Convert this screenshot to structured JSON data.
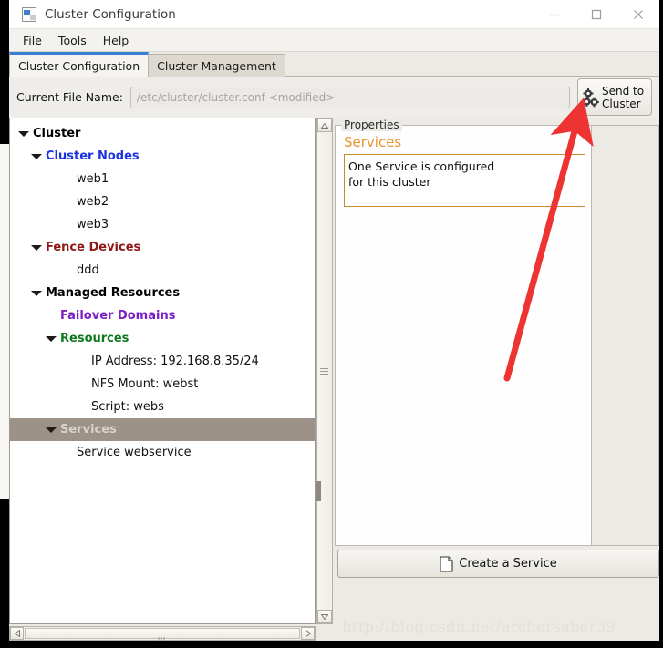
{
  "window": {
    "title": "Cluster Configuration",
    "icon": "app-icon",
    "controls": {
      "minimize": "minimize-icon",
      "maximize": "maximize-icon",
      "close": "close-icon"
    }
  },
  "menubar": {
    "items": [
      {
        "label": "File",
        "mnemonic": "F"
      },
      {
        "label": "Tools",
        "mnemonic": "T"
      },
      {
        "label": "Help",
        "mnemonic": "H"
      }
    ]
  },
  "tabs": [
    {
      "label": "Cluster Configuration",
      "active": true
    },
    {
      "label": "Cluster Management",
      "active": false
    }
  ],
  "toolbar": {
    "file_label": "Current File Name:",
    "file_value": "/etc/cluster/cluster.conf  <modified>",
    "file_placeholder": "/etc/cluster/cluster.conf  <modified>",
    "send_line1": "Send to",
    "send_line2": "Cluster",
    "send_icon": "gears-icon"
  },
  "tree": {
    "items": [
      {
        "label": "Cluster",
        "indent": 0,
        "arrow": true,
        "color": "#000000",
        "bold": true,
        "selected": false
      },
      {
        "label": "Cluster Nodes",
        "indent": 1,
        "arrow": true,
        "color": "#1b34e0",
        "bold": true,
        "selected": false
      },
      {
        "label": "web1",
        "indent": 3,
        "arrow": false,
        "color": "#111111",
        "bold": false,
        "selected": false
      },
      {
        "label": "web2",
        "indent": 3,
        "arrow": false,
        "color": "#111111",
        "bold": false,
        "selected": false
      },
      {
        "label": "web3",
        "indent": 3,
        "arrow": false,
        "color": "#111111",
        "bold": false,
        "selected": false
      },
      {
        "label": "Fence Devices",
        "indent": 1,
        "arrow": true,
        "color": "#8f1717",
        "bold": true,
        "selected": false
      },
      {
        "label": "ddd",
        "indent": 3,
        "arrow": false,
        "color": "#111111",
        "bold": false,
        "selected": false
      },
      {
        "label": "Managed Resources",
        "indent": 1,
        "arrow": true,
        "color": "#000000",
        "bold": true,
        "selected": false
      },
      {
        "label": "Failover Domains",
        "indent": 2,
        "arrow": false,
        "color": "#7a1ec4",
        "bold": true,
        "selected": false
      },
      {
        "label": "Resources",
        "indent": 2,
        "arrow": true,
        "color": "#0d7a1f",
        "bold": true,
        "selected": false
      },
      {
        "label": "IP Address:  192.168.8.35/24",
        "indent": 4,
        "arrow": false,
        "color": "#111111",
        "bold": false,
        "selected": false
      },
      {
        "label": "NFS Mount:  webst",
        "indent": 4,
        "arrow": false,
        "color": "#111111",
        "bold": false,
        "selected": false
      },
      {
        "label": "Script:  webs",
        "indent": 4,
        "arrow": false,
        "color": "#111111",
        "bold": false,
        "selected": false
      },
      {
        "label": "Services",
        "indent": 2,
        "arrow": true,
        "color": "#d8d4cd",
        "bold": true,
        "selected": true
      },
      {
        "label": "Service webservice",
        "indent": 3,
        "arrow": false,
        "color": "#111111",
        "bold": false,
        "selected": false
      }
    ]
  },
  "properties": {
    "legend": "Properties",
    "title": "Services",
    "body_line1": "One Service is configured",
    "body_line2": " for this cluster",
    "create_label": "Create a Service",
    "create_icon": "document-icon"
  },
  "scrollbars": {
    "vertical_up": "scroll-up-arrow",
    "vertical_down": "scroll-down-arrow",
    "horizontal_left": "scroll-left-arrow",
    "horizontal_right": "scroll-right-arrow"
  },
  "watermark": {
    "text": "http://blog.csdn.net/archersaber39"
  },
  "annotation": {
    "arrow_color": "#ee3333"
  },
  "colors": {
    "accent_blue": "#3a7fd5",
    "selection": "#9c9287",
    "props_orange": "#e8952f",
    "props_border_orange": "#c98b2a"
  }
}
